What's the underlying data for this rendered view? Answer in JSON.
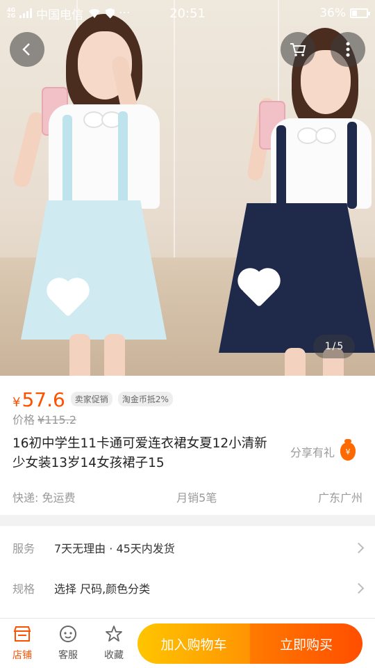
{
  "status_bar": {
    "network_top": "4G",
    "network_bottom": "2G",
    "carrier": "中国电信",
    "dots": "···",
    "time": "20:51",
    "battery_percent": "36%",
    "battery_level": 0.36
  },
  "gallery": {
    "current": "1",
    "separator": "/",
    "total": "5"
  },
  "price": {
    "symbol": "¥",
    "value": "57.6",
    "tags": [
      "卖家促销",
      "淘金币抵2%"
    ],
    "original_label": "价格",
    "original_value": "¥115.2"
  },
  "product": {
    "title": "16初中学生11卡通可爱连衣裙女夏12小清新少女装13岁14女孩裙子15",
    "share_label": "分享有礼",
    "shipping": "快递: 免运费",
    "monthly_sales": "月销5笔",
    "location": "广东广州"
  },
  "service": {
    "label": "服务",
    "value": "7天无理由 · 45天内发货"
  },
  "spec": {
    "label": "规格",
    "value": "选择 尺码,颜色分类"
  },
  "bottom_bar": {
    "shop": "店铺",
    "customer_service": "客服",
    "favorite": "收藏",
    "add_to_cart": "加入购物车",
    "buy_now": "立即购买"
  },
  "colors": {
    "accent": "#ff5000",
    "cart_button": "#ffa200",
    "buy_button": "#ff5a00",
    "light_blue_dress": "#cfeaf0",
    "navy_dress": "#1f2a4a"
  },
  "icons": {
    "back": "chevron-left-icon",
    "cart": "cart-icon",
    "more": "more-vertical-icon",
    "shop": "shop-icon",
    "service": "chat-face-icon",
    "favorite": "star-icon",
    "share": "money-bag-icon"
  }
}
